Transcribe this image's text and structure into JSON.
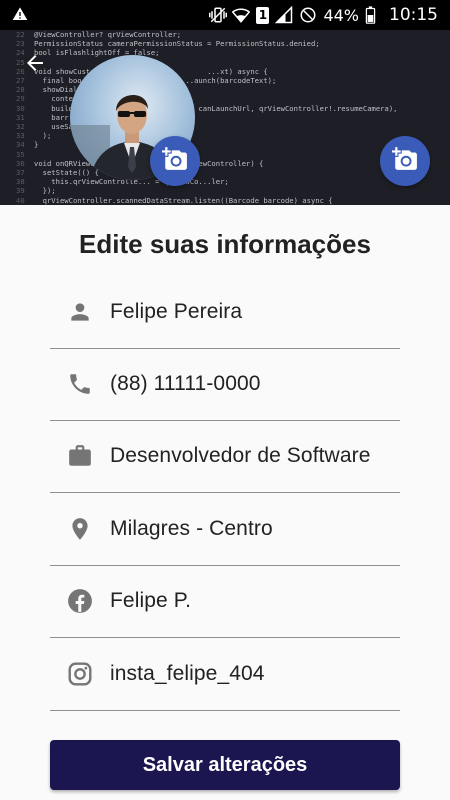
{
  "statusbar": {
    "battery": "44%",
    "time": "10:15",
    "sim_slot": "1",
    "icons": [
      "warning-icon",
      "vibrate-icon",
      "wifi-icon",
      "sim-1-icon",
      "signal-icon",
      "do-not-disturb-icon",
      "battery-icon"
    ]
  },
  "cover": {
    "code_lines": [
      "@ViewController? qrViewController;",
      "PermissionStatus cameraPermissionStatus = PermissionStatus.denied;",
      "bool isFlashlightOff = false;",
      "",
      "void showCustom...                      ...xt) async {",
      "  final boo...                    ...aunch(barcodeText);",
      "  showDial...",
      "    conte...",
      "    build...                  ...ext, canLaunchUrl, qrViewController!.resumeCamera),",
      "    barr...",
      "    useSa...",
      "  );",
      "}",
      "",
      "void onQRViewC...                  ...ewController) {",
      "  setState(() {",
      "    this.qrViewControlle... = qrViewCo...ler;",
      "  });",
      "  qrViewController.scannedDataStream.listen((Barcode barcode) async {"
    ],
    "line_numbers": [
      "22",
      "23",
      "24",
      "25",
      "26",
      "27",
      "28",
      "29",
      "30",
      "31",
      "32",
      "33",
      "34",
      "35",
      "36",
      "37",
      "38",
      "39",
      "40"
    ]
  },
  "back_icon": "arrow-back-icon",
  "avatar_icon": "add-a-photo-icon",
  "title": "Edite suas informações",
  "fields": [
    {
      "name": "name",
      "icon": "person-icon",
      "value": "Felipe Pereira"
    },
    {
      "name": "phone",
      "icon": "phone-icon",
      "value": "(88) 11111-0000"
    },
    {
      "name": "job",
      "icon": "briefcase-icon",
      "value": "Desenvolvedor de Software"
    },
    {
      "name": "location",
      "icon": "location-pin-icon",
      "value": "Milagres - Centro"
    },
    {
      "name": "facebook",
      "icon": "facebook-icon",
      "value": "Felipe P."
    },
    {
      "name": "instagram",
      "icon": "instagram-icon",
      "value": "insta_felipe_404"
    }
  ],
  "save_label": "Salvar alterações",
  "colors": {
    "primary_button": "#1b1650",
    "fab": "#3a5bb7",
    "icon": "#757575",
    "cover_bg": "#1e1f26"
  }
}
